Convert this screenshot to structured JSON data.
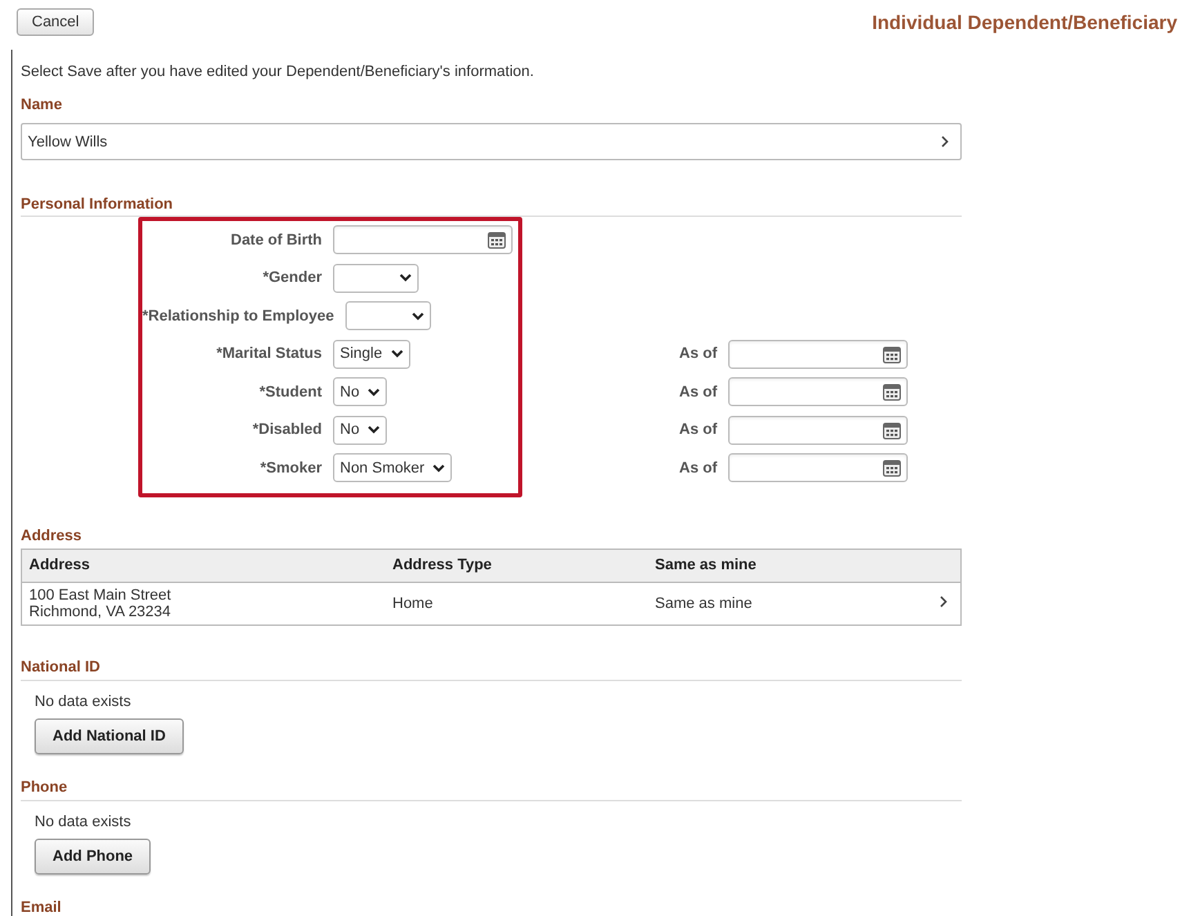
{
  "header": {
    "cancel_button": "Cancel",
    "title": "Individual Dependent/Beneficiary"
  },
  "instruction": "Select Save after you have edited your Dependent/Beneficiary's information.",
  "name_section": {
    "heading": "Name",
    "value": "Yellow Wills"
  },
  "personal_information": {
    "heading": "Personal Information",
    "highlighted": true,
    "fields": [
      {
        "kind": "date",
        "label": "Date of Birth"
      },
      {
        "kind": "select",
        "label": "*Gender"
      },
      {
        "kind": "select",
        "label": "*Relationship to Employee"
      },
      {
        "kind": "select",
        "label": "*Marital Status",
        "value": "Single",
        "as_of": "As of"
      },
      {
        "kind": "select",
        "label": "*Student",
        "value": "No",
        "as_of": "As of"
      },
      {
        "kind": "select",
        "label": "*Disabled",
        "value": "No",
        "as_of": "As of"
      },
      {
        "kind": "select",
        "label": "*Smoker",
        "value": "Non Smoker",
        "as_of": "As of"
      }
    ]
  },
  "address": {
    "heading": "Address",
    "columns": [
      "Address",
      "Address Type",
      "Same as mine"
    ],
    "rows": [
      {
        "address": [
          "100 East Main Street",
          "Richmond, VA 23234"
        ],
        "address_type": "Home",
        "same_as_mine": "Same as mine"
      }
    ]
  },
  "national_id": {
    "heading": "National ID",
    "empty_text": "No data exists",
    "button": "Add National ID"
  },
  "phone": {
    "heading": "Phone",
    "empty_text": "No data exists",
    "button": "Add Phone"
  },
  "email": {
    "heading": "Email"
  }
}
